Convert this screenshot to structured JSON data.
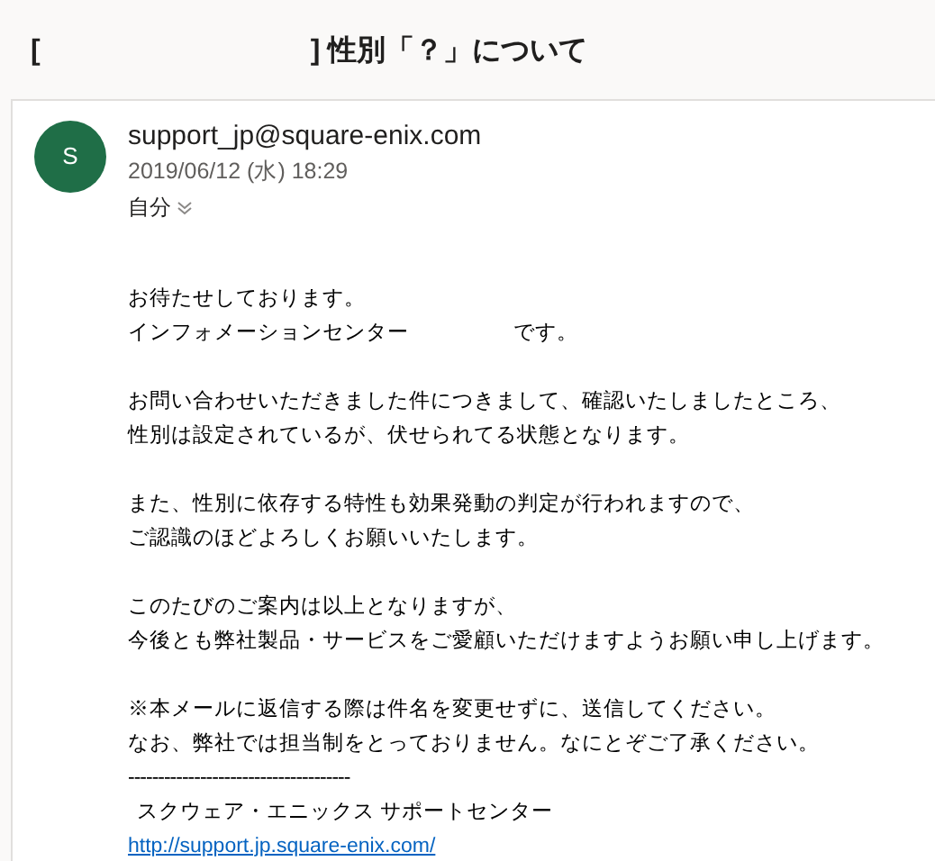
{
  "subject": {
    "open_bracket": "[",
    "rest": "] 性別「？」について"
  },
  "message": {
    "avatar_letter": "S",
    "sender": "support_jp@square-enix.com",
    "date": "2019/06/12 (水) 18:29",
    "recipient": "自分",
    "paragraphs": [
      [
        {
          "kind": "text",
          "parts": [
            "お待たせしております。"
          ]
        },
        {
          "kind": "text",
          "parts": [
            "インフォメーションセンター",
            "です。"
          ]
        }
      ],
      [
        {
          "kind": "text",
          "parts": [
            "お問い合わせいただきました件につきまして、確認いたしましたところ、"
          ]
        },
        {
          "kind": "text",
          "parts": [
            "性別は設定されているが、伏せられてる状態となります。"
          ]
        }
      ],
      [
        {
          "kind": "text",
          "parts": [
            "また、性別に依存する特性も効果発動の判定が行われますので、"
          ]
        },
        {
          "kind": "text",
          "parts": [
            "ご認識のほどよろしくお願いいたします。"
          ]
        }
      ],
      [
        {
          "kind": "text",
          "parts": [
            "このたびのご案内は以上となりますが、"
          ]
        },
        {
          "kind": "text",
          "parts": [
            "今後とも弊社製品・サービスをご愛顧いただけますようお願い申し上げます。"
          ]
        }
      ],
      [
        {
          "kind": "text",
          "parts": [
            "※本メールに返信する際は件名を変更せずに、送信してください。"
          ]
        },
        {
          "kind": "text",
          "parts": [
            "なお、弊社では担当制をとっておりません。なにとぞご了承ください。"
          ]
        },
        {
          "kind": "rule",
          "parts": [
            "-------------------------------------"
          ]
        },
        {
          "kind": "signature",
          "parts": [
            "スクウェア・エニックス サポートセンター"
          ]
        },
        {
          "kind": "link",
          "parts": [
            "http://support.jp.square-enix.com/"
          ]
        }
      ]
    ]
  }
}
